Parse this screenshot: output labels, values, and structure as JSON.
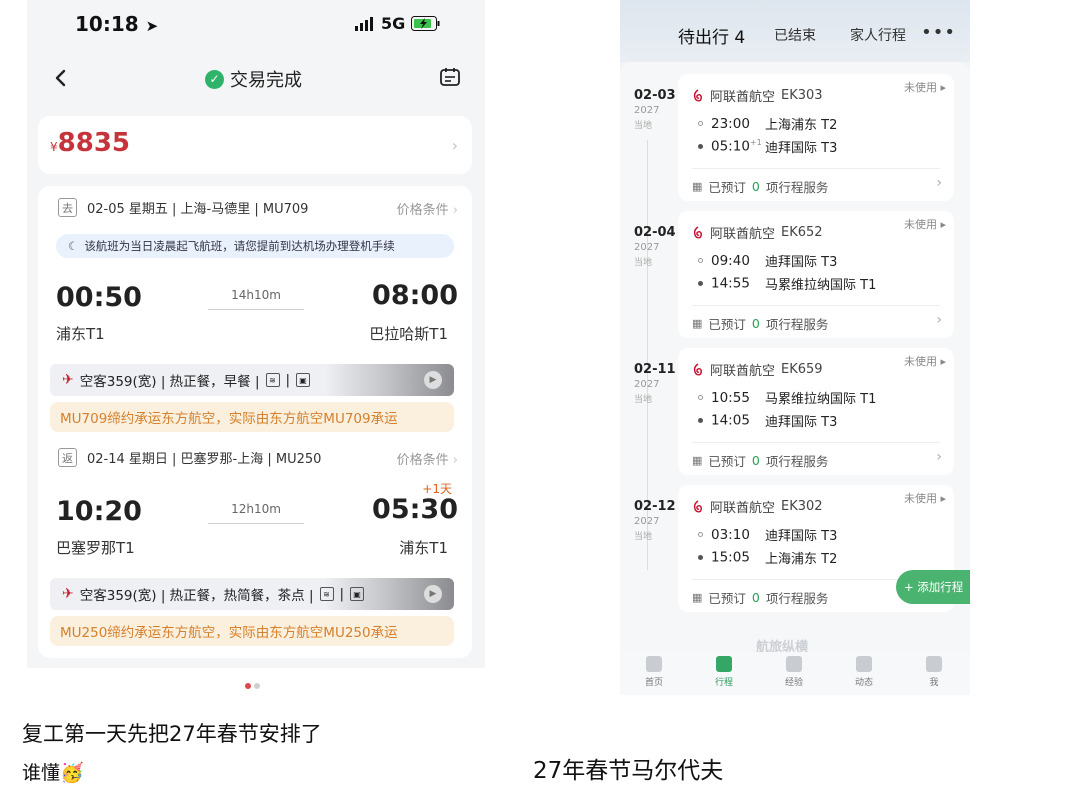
{
  "left_phone": {
    "status": {
      "time": "10:18",
      "network": "5G"
    },
    "nav": {
      "title": "交易完成"
    },
    "price": {
      "currency": "¥",
      "amount": "8835"
    },
    "outbound": {
      "tag": "去",
      "summary": "02-05 星期五 | 上海-马德里 | MU709",
      "price_condition": "价格条件",
      "notice": "该航班为当日凌晨起飞航班，请您提前到达机场办理登机手续",
      "dep_time": "00:50",
      "duration": "14h10m",
      "arr_time": "08:00",
      "dep_terminal": "浦东T1",
      "arr_terminal": "巴拉哈斯T1",
      "aircraft": "空客359(宽) | 热正餐，早餐 |",
      "codeshare": "MU709缔约承运东方航空，实际由东方航空MU709承运"
    },
    "return": {
      "tag": "返",
      "summary": "02-14 星期日 | 巴塞罗那-上海 | MU250",
      "price_condition": "价格条件",
      "dep_time": "10:20",
      "duration": "12h10m",
      "arr_time": "05:30",
      "plus_day": "+1天",
      "dep_terminal": "巴塞罗那T1",
      "arr_terminal": "浦东T1",
      "aircraft": "空客359(宽) | 热正餐，热简餐，茶点 |",
      "codeshare": "MU250缔约承运东方航空，实际由东方航空MU250承运"
    }
  },
  "captions": {
    "left_line1": "复工第一天先把27年春节安排了",
    "left_line2": "谁懂🥳",
    "right": "27年春节马尔代夫"
  },
  "right_phone": {
    "tabs": [
      "待出行 4",
      "已结束",
      "家人行程"
    ],
    "more": "•••",
    "trips": [
      {
        "date": "02-03",
        "year": "2027",
        "local": "当地",
        "airline": "阿联酋航空",
        "flight": "EK303",
        "status": "未使用",
        "dep_time": "23:00",
        "dep_place": "上海浦东 T2",
        "arr_time": "05:10",
        "arr_plus": "+1",
        "arr_place": "迪拜国际 T3",
        "footer_prefix": "已预订",
        "footer_count": "0",
        "footer_suffix": "项行程服务"
      },
      {
        "date": "02-04",
        "year": "2027",
        "local": "当地",
        "airline": "阿联酋航空",
        "flight": "EK652",
        "status": "未使用",
        "dep_time": "09:40",
        "dep_place": "迪拜国际 T3",
        "arr_time": "14:55",
        "arr_plus": "",
        "arr_place": "马累维拉纳国际 T1",
        "footer_prefix": "已预订",
        "footer_count": "0",
        "footer_suffix": "项行程服务"
      },
      {
        "date": "02-11",
        "year": "2027",
        "local": "当地",
        "airline": "阿联酋航空",
        "flight": "EK659",
        "status": "未使用",
        "dep_time": "10:55",
        "dep_place": "马累维拉纳国际 T1",
        "arr_time": "14:05",
        "arr_plus": "",
        "arr_place": "迪拜国际 T3",
        "footer_prefix": "已预订",
        "footer_count": "0",
        "footer_suffix": "项行程服务"
      },
      {
        "date": "02-12",
        "year": "2027",
        "local": "当地",
        "airline": "阿联酋航空",
        "flight": "EK302",
        "status": "未使用",
        "dep_time": "03:10",
        "dep_place": "迪拜国际 T3",
        "arr_time": "15:05",
        "arr_plus": "",
        "arr_place": "上海浦东 T2",
        "footer_prefix": "已预订",
        "footer_count": "0",
        "footer_suffix": "项行程服务"
      }
    ],
    "add_trip": "+ 添加行程",
    "watermark": "航旅纵横",
    "tabbar": [
      "首页",
      "行程",
      "经验",
      "动态",
      "我"
    ]
  }
}
